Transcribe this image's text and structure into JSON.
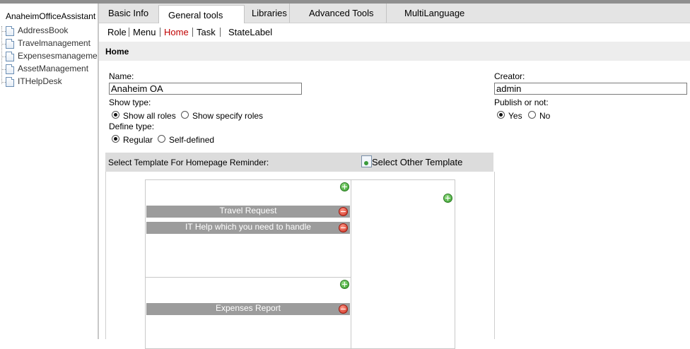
{
  "tree": {
    "root": "AnaheimOfficeAssistant",
    "items": [
      "AddressBook",
      "Travelmanagement",
      "Expensesmanagement",
      "AssetManagement",
      "ITHelpDesk"
    ]
  },
  "tabs": [
    "Basic Info",
    "General tools",
    "Libraries",
    "Advanced Tools",
    "MultiLanguage"
  ],
  "active_tab": "General tools",
  "subnav": [
    "Role",
    "Menu",
    "Home",
    "Task",
    "StateLabel"
  ],
  "current_subnav": "Home",
  "section_title": "Home",
  "form": {
    "name_label": "Name:",
    "name_value": "Anaheim OA",
    "show_type_label": "Show type:",
    "show_all_roles": "Show all roles",
    "show_specify_roles": "Show specify roles",
    "define_type_label": "Define type:",
    "regular": "Regular",
    "self_defined": "Self-defined",
    "creator_label": "Creator:",
    "creator_value": "admin",
    "publish_label": "Publish or not:",
    "yes": "Yes",
    "no": "No"
  },
  "template": {
    "header": "Select Template For Homepage Reminder:",
    "select_other": "Select Other Template",
    "items": [
      "Travel Request",
      "IT Help which you need to handle",
      "Expenses Report"
    ]
  }
}
